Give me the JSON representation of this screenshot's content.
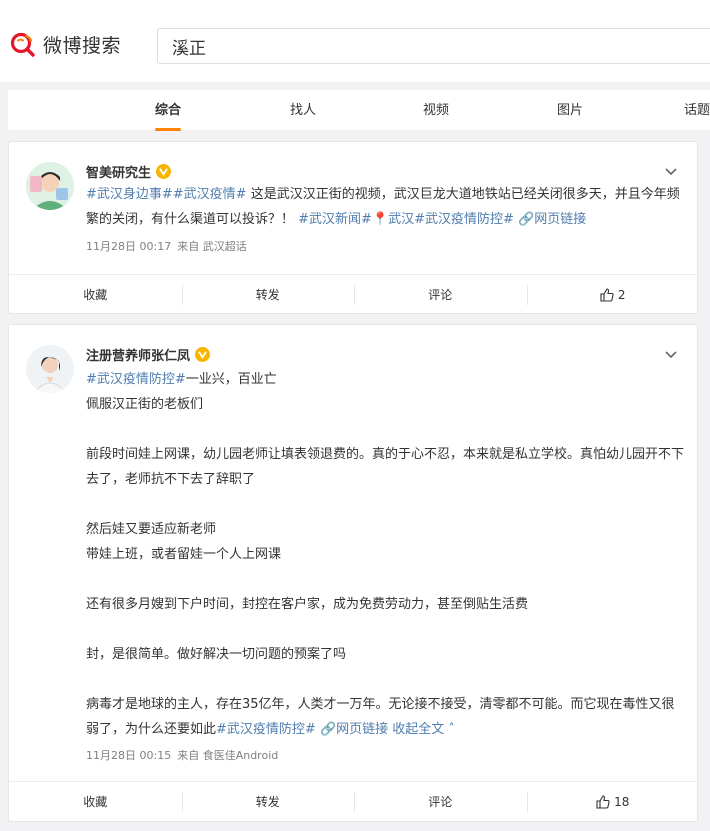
{
  "app": {
    "logo_text": "微博搜索"
  },
  "search": {
    "value": "溪正"
  },
  "tabs": [
    {
      "label": "综合",
      "active": true
    },
    {
      "label": "找人"
    },
    {
      "label": "视频"
    },
    {
      "label": "图片"
    },
    {
      "label": "话题"
    }
  ],
  "posts": [
    {
      "user": "智美研究生",
      "text": {
        "p1": [
          {
            "t": "#武汉身边事##武汉疫情#",
            "link": true
          },
          {
            "t": " 这是武汉汉正街的视频，武汉巨龙大道地铁站已经关闭很多天，并且今年频繁的关闭，有什么渠道可以投诉？！ "
          },
          {
            "t": "#武汉新闻#",
            "link": true
          },
          {
            "t": "📍武汉",
            "link": true
          },
          {
            "t": "#武汉疫情防控#",
            "link": true
          },
          {
            "t": " 🔗网页链接",
            "link": true
          }
        ]
      },
      "time": "11月28日 00:17",
      "source": "来自 武汉超话",
      "actions": {
        "collect": "收藏",
        "repost": "转发",
        "comment": "评论",
        "likes": "2"
      }
    },
    {
      "user": "注册营养师张仁凤",
      "text": {
        "p1": [
          {
            "t": "#武汉疫情防控#",
            "link": true
          },
          {
            "t": "一业兴，百业亡"
          }
        ],
        "p2": "佩服汉正街的老板们",
        "p3": "前段时间娃上网课，幼儿园老师让填表领退费的。真的于心不忍，本来就是私立学校。真怕幼儿园开不下去了，老师抗不下去了辞职了",
        "p4": "然后娃又要适应新老师",
        "p5": "带娃上班，或者留娃一个人上网课",
        "p6": "还有很多月嫂到下户时间，封控在客户家，成为免费劳动力，甚至倒贴生活费",
        "p7": "封，是很简单。做好解决一切问题的预案了吗",
        "p8": [
          {
            "t": "病毒才是地球的主人，存在35亿年，人类才一万年。无论接不接受，清零都不可能。而它现在毒性又很弱了，为什么还要如此"
          },
          {
            "t": "#武汉疫情防控#",
            "link": true
          },
          {
            "t": " 🔗网页链接",
            "link": true
          },
          {
            "t": " 收起全文 ˄",
            "link": true
          }
        ]
      },
      "time": "11月28日 00:15",
      "source": "来自 食医佳Android",
      "actions": {
        "collect": "收藏",
        "repost": "转发",
        "comment": "评论",
        "likes": "18"
      }
    }
  ],
  "colors": {
    "accent": "#ff8200",
    "link": "#507daf",
    "verified": "#f7b500"
  }
}
